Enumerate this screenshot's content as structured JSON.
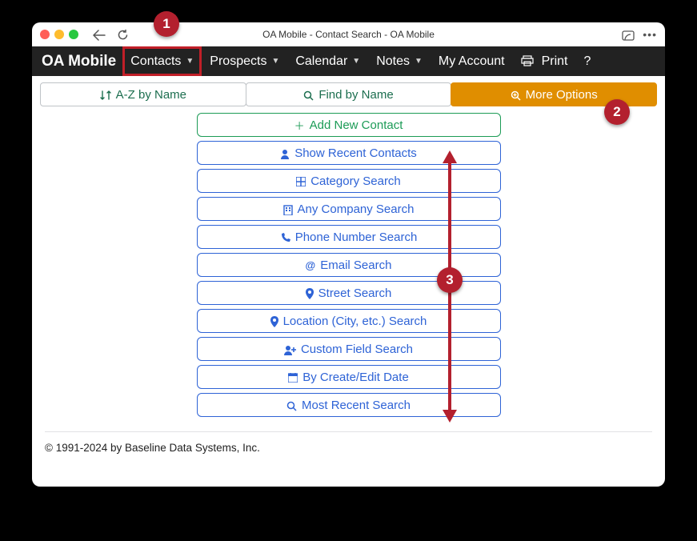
{
  "window": {
    "title": "OA Mobile - Contact Search - OA Mobile"
  },
  "menubar": {
    "brand": "OA Mobile",
    "contacts": "Contacts",
    "prospects": "Prospects",
    "calendar": "Calendar",
    "notes": "Notes",
    "myaccount": "My Account",
    "print": "Print",
    "help": "?"
  },
  "tabs": {
    "az": "A-Z by Name",
    "find": "Find by Name",
    "more": "More Options"
  },
  "options": {
    "add": "Add New Contact",
    "recent": "Show Recent Contacts",
    "category": "Category Search",
    "company": "Any Company Search",
    "phone": "Phone Number Search",
    "email": "Email Search",
    "street": "Street Search",
    "location": "Location (City, etc.) Search",
    "custom": "Custom Field Search",
    "date": "By Create/Edit Date",
    "mostrecent": "Most Recent Search"
  },
  "footer": {
    "copyright": "© 1991-2024 by Baseline Data Systems, Inc."
  },
  "callouts": {
    "c1": "1",
    "c2": "2",
    "c3": "3"
  }
}
